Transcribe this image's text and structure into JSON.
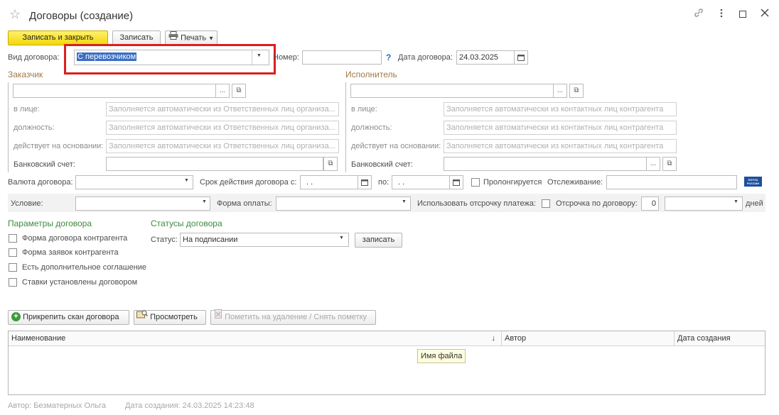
{
  "window": {
    "title": "Договоры (создание)",
    "icons": [
      "star-icon",
      "link-icon",
      "more-vert-icon",
      "maximize-icon",
      "close-icon"
    ]
  },
  "toolbar": {
    "save_close": "Записать и закрыть",
    "save": "Записать",
    "print": "Печать"
  },
  "contract": {
    "type_label": "Вид договора:",
    "type_value": "С перевозчиком",
    "number_label": "Номер:",
    "number_value": "",
    "help": "?",
    "date_label": "Дата договора:",
    "date_value": "24.03.2025"
  },
  "customer": {
    "title": "Заказчик",
    "person_label": "в лице:",
    "person_ph": "Заполняется автоматически из Ответственных лиц организа...",
    "position_label": "должность:",
    "position_ph": "Заполняется автоматически из Ответственных лиц организа...",
    "basis_label": "действует на основании:",
    "basis_ph": "Заполняется автоматически из Ответственных лиц организа...",
    "bank_label": "Банковский счет:"
  },
  "executor": {
    "title": "Исполнитель",
    "person_label": "в лице:",
    "person_ph": "Заполняется автоматически из контактных лиц контрагента",
    "position_label": "должность:",
    "position_ph": "Заполняется автоматически из контактных лиц контрагента",
    "basis_label": "действует на основании:",
    "basis_ph": "Заполняется автоматически из контактных лиц контрагента",
    "bank_label": "Банковский счет:"
  },
  "terms": {
    "currency_label": "Валюта договора:",
    "period_from_label": "Срок действия договора с:",
    "period_from_value": ". .",
    "period_to_label": "по:",
    "period_to_value": ". .",
    "prolong_label": "Пролонгируется",
    "tracking_label": "Отслеживание:",
    "post_logo": "ПОЧТА РОССИИ",
    "condition_label": "Условие:",
    "payment_form_label": "Форма оплаты:",
    "deferral_label": "Использовать отсрочку платежа:",
    "deferral_days_label": "Отсрочка по договору:",
    "deferral_days_value": "0",
    "days_label": "дней"
  },
  "params": {
    "title": "Параметры договора",
    "items": [
      "Форма договора контрагента",
      "Форма заявок контрагента",
      "Есть дополнительное соглашение",
      "Ставки установлены договором"
    ]
  },
  "statuses": {
    "title": "Статусы договора",
    "status_label": "Статус:",
    "status_value": "На подписании",
    "save_button": "записать"
  },
  "scans": {
    "attach": "Прикрепить скан договора",
    "view": "Просмотреть",
    "mark_delete": "Пометить на удаление / Снять пометку",
    "columns": [
      "Наименование",
      "Автор",
      "Дата создания"
    ],
    "sort_indicator": "↓",
    "tooltip": "Имя файла"
  },
  "footer": {
    "author": "Автор: Безматерных Ольга",
    "created": "Дата создания: 24.03.2025 14:23:48"
  },
  "colors": {
    "primary_button": "#f2d70c",
    "section_title": "#a0794a",
    "section_title_green": "#3d8a3d",
    "highlight_box": "#d9201e",
    "selection": "#3b6fc4"
  }
}
